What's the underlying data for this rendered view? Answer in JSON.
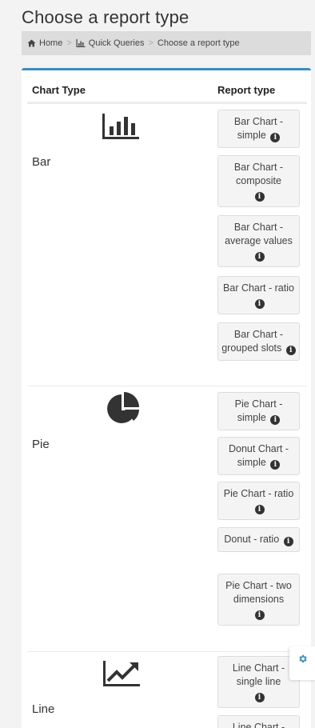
{
  "page": {
    "title": "Choose a report type"
  },
  "breadcrumb": {
    "items": [
      {
        "label": "Home",
        "icon": "home-icon"
      },
      {
        "label": "Quick Queries",
        "icon": "bar-chart-icon"
      },
      {
        "label": "Choose a report type"
      }
    ],
    "separator": ">"
  },
  "table": {
    "headers": {
      "chart_type": "Chart Type",
      "report_type": "Report type"
    },
    "groups": [
      {
        "name": "Bar",
        "icon": "bar-chart-icon",
        "reports": [
          "Bar Chart - simple",
          "Bar Chart - composite",
          "Bar Chart - average values",
          "Bar Chart - ratio",
          "Bar Chart - grouped slots"
        ]
      },
      {
        "name": "Pie",
        "icon": "pie-chart-icon",
        "reports": [
          "Pie Chart - simple",
          "Donut Chart - simple",
          "Pie Chart - ratio",
          "Donut - ratio",
          "Pie Chart - two dimensions"
        ]
      },
      {
        "name": "Line",
        "icon": "line-chart-icon",
        "reports": [
          "Line Chart - single line",
          "Line Chart -"
        ]
      }
    ]
  },
  "settings": {
    "icon": "gear-icon"
  },
  "colors": {
    "accent": "#3c8dbc",
    "gear": "#3c8dbc",
    "breadcrumb_bg": "#dcdcdc",
    "page_bg": "#f3f3f3"
  }
}
